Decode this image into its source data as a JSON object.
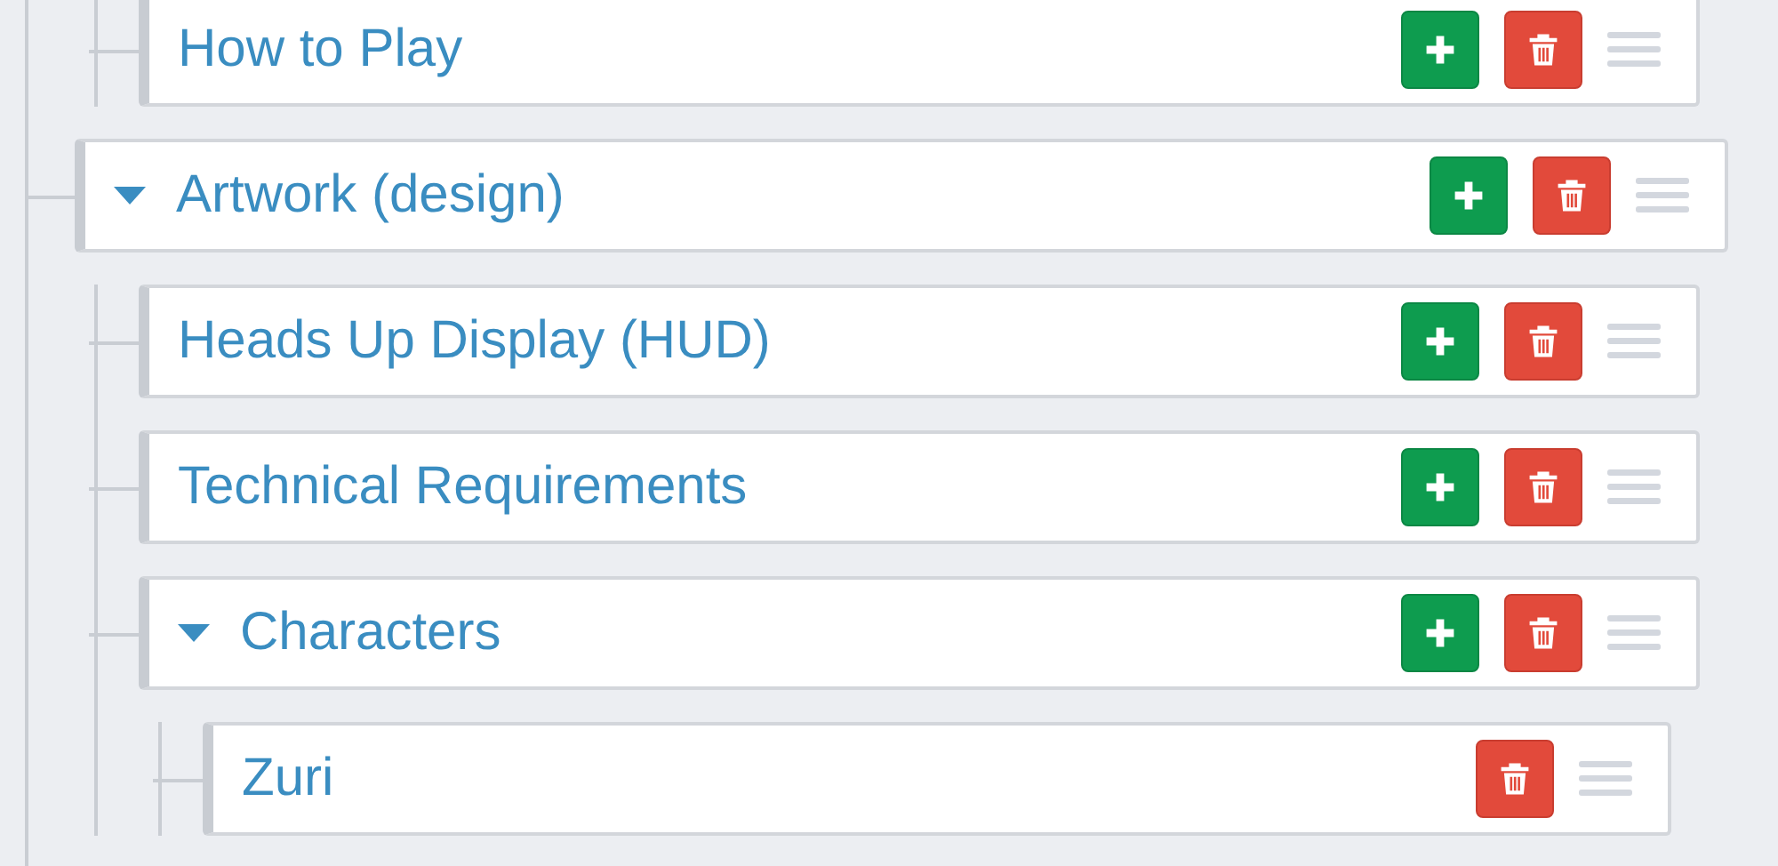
{
  "tree": [
    {
      "children": [
        {
          "label": "How to Play",
          "can_add": true
        }
      ]
    },
    {
      "label": "Artwork (design)",
      "expanded": true,
      "can_add": true,
      "children": [
        {
          "label": "Heads Up Display (HUD)",
          "can_add": true
        },
        {
          "label": "Technical Requirements",
          "can_add": true
        },
        {
          "label": "Characters",
          "expanded": true,
          "can_add": true,
          "children": [
            {
              "label": "Zuri",
              "can_add": false
            }
          ]
        }
      ]
    }
  ]
}
